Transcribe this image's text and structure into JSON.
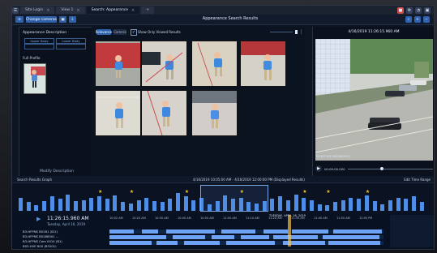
{
  "tabs": [
    {
      "label": "Site Login",
      "close": "×"
    },
    {
      "label": "View 1",
      "close": "×"
    },
    {
      "label": "Search: Appearance",
      "close": "×"
    },
    {
      "label": "+",
      "close": ""
    }
  ],
  "top_icons": [
    "blue-square-icon",
    "gear-icon",
    "bell-icon",
    "window-icon"
  ],
  "toolbar": {
    "change_camera": "Change cameras",
    "title": "Appearance Search Results"
  },
  "left_panel": {
    "title": "Appearance Description",
    "chips": [
      "Upper Body",
      "Lower Body"
    ],
    "full_profile": "Full Profile",
    "bottom_label": "Modify Description"
  },
  "results": {
    "relevance": "Relevance",
    "camera": "Camera",
    "show_label": "Show Only Viewed Results",
    "check_mark": "✓"
  },
  "video": {
    "title": "4/16/2019 11:26:15.960 AM",
    "camera_label": "TELEFFICE (B0288501)",
    "time": "00:00:00.000"
  },
  "timeline": {
    "left_label": "Search Results Graph",
    "range_label": "4/16/2019 10:05:00 AM  -  4/16/2019 12:00:00 PM  (Displayed Results)",
    "right_label": "Edit Time Range",
    "ticks": [
      "10:05 AM",
      "11:00 AM",
      "11:05 AM",
      "11:10 AM",
      "11:15 AM",
      "11:20 AM",
      "11:25 AM",
      "11:30 AM",
      "11:35 AM",
      "11:40 AM",
      "11:45 AM",
      "11:50 AM",
      "11:55 AM",
      "12:00 PM"
    ],
    "histogram_values": [
      12,
      8,
      5,
      9,
      13,
      11,
      15,
      9,
      10,
      12,
      13,
      11,
      14,
      8,
      7,
      10,
      12,
      9,
      8,
      11,
      16,
      13,
      10,
      12,
      6,
      9,
      14,
      11,
      12,
      8,
      7,
      9,
      11,
      13,
      10,
      15,
      12,
      10,
      6,
      5,
      8,
      10,
      12,
      11,
      14,
      9,
      6,
      10,
      12,
      11,
      13,
      8
    ],
    "stars": [
      10,
      14,
      21,
      28,
      36,
      39,
      44
    ]
  },
  "bottom": {
    "time": "11:26:15.960 AM",
    "date": "Tuesday, April 16, 2019",
    "cams": [
      "B3-HFPNS B0281 (ID1)",
      "B3-HFPNS B0288501 ...",
      "B3-HFPNS Cam 0014 (B1)",
      "B03-HVE 800 (B3201)"
    ],
    "date_strip": "TUESDAY, APRIL 16, 2019",
    "axis": [
      "10:02 AM",
      "10:20 AM",
      "10:30 AM",
      "10:40 AM",
      "10:50 AM",
      "11:00 AM",
      "11:10 AM",
      "11:20 AM",
      "11:30 AM",
      "11:40 AM",
      "11:50 AM",
      "12:00 PM",
      "12:10 PM",
      "12:20 PM"
    ]
  }
}
